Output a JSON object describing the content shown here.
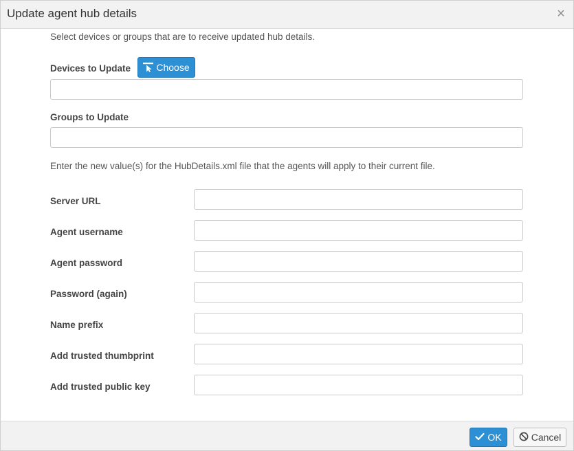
{
  "dialog": {
    "title": "Update agent hub details",
    "close_glyph": "×",
    "intro": "Select devices or groups that are to receive updated hub details.",
    "devices_label": "Devices to Update",
    "choose_label": "Choose",
    "devices_value": "",
    "groups_label": "Groups to Update",
    "groups_value": "",
    "description": "Enter the new value(s) for the HubDetails.xml file that the agents will apply to their current file.",
    "fields": [
      {
        "label": "Server URL",
        "value": ""
      },
      {
        "label": "Agent username",
        "value": ""
      },
      {
        "label": "Agent password",
        "value": ""
      },
      {
        "label": "Password (again)",
        "value": ""
      },
      {
        "label": "Name prefix",
        "value": ""
      },
      {
        "label": "Add trusted thumbprint",
        "value": ""
      },
      {
        "label": "Add trusted public key",
        "value": ""
      }
    ]
  },
  "footer": {
    "ok_label": "OK",
    "cancel_label": "Cancel"
  },
  "icons": {
    "choose": "pointer-select-icon",
    "ok": "checkmark-icon",
    "cancel": "ban-icon",
    "close": "close-icon"
  },
  "colors": {
    "primary": "#2d8fd4",
    "header_bg": "#f2f2f2",
    "border": "#c8c8c8"
  }
}
